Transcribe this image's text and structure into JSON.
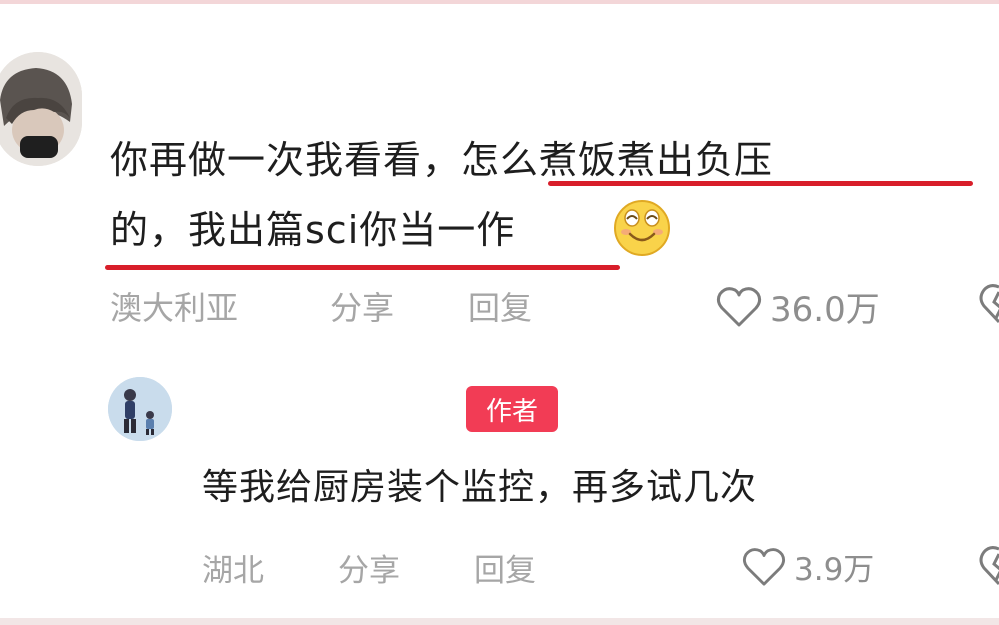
{
  "comments": [
    {
      "text_line1_plain": "你再做一次我看看，",
      "text_line1_marked": "怎么煮饭煮出负压",
      "text_line2": "的，我出篇sci你当一作",
      "emoji": "smile-emoji",
      "location": "澳大利亚",
      "share_label": "分享",
      "reply_label": "回复",
      "likes": "36.0万"
    }
  ],
  "reply": {
    "badge": "作者",
    "text": "等我给厨房装个监控，再多试几次",
    "location": "湖北",
    "share_label": "分享",
    "reply_label": "回复",
    "likes": "3.9万"
  },
  "colors": {
    "underline": "#d81e2a",
    "badge": "#f23c55",
    "meta": "#a6a6a6"
  }
}
